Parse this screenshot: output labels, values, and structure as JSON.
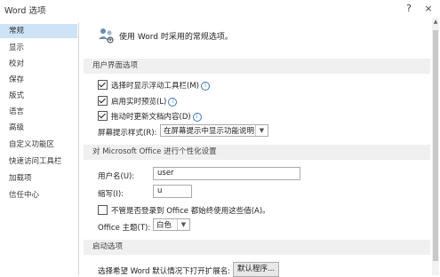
{
  "window": {
    "title": "Word 选项",
    "help": "?",
    "close": "×"
  },
  "sidebar": {
    "items": [
      {
        "label": "常规"
      },
      {
        "label": "显示"
      },
      {
        "label": "校对"
      },
      {
        "label": "保存"
      },
      {
        "label": "版式"
      },
      {
        "label": "语言"
      },
      {
        "label": "高级"
      },
      {
        "label": "自定义功能区"
      },
      {
        "label": "快速访问工具栏"
      },
      {
        "label": "加载项"
      },
      {
        "label": "信任中心"
      }
    ],
    "selected": "常规"
  },
  "main": {
    "intro": "使用 Word 时采用的常规选项。",
    "ui_section": {
      "header": "用户界面选项",
      "options": [
        {
          "label": "选择时显示浮动工具栏(M)",
          "checked": true
        },
        {
          "label": "启用实时预览(L)",
          "checked": true
        },
        {
          "label": "拖动时更新文档内容(D)",
          "checked": true
        }
      ],
      "tooltip_label": "屏幕提示样式(R):",
      "tooltip_value": "在屏幕提示中显示功能说明"
    },
    "personalize_section": {
      "header": "对 Microsoft Office 进行个性化设置",
      "username_label": "用户名(U):",
      "username_value": "user",
      "initials_label": "缩写(I):",
      "initials_value": "u",
      "always_use_label": "不管是否登录到 Office 都始终使用这些值(A)。",
      "always_use_checked": false,
      "theme_label": "Office 主题(T):",
      "theme_value": "白色"
    },
    "startup_section": {
      "header": "启动选项",
      "extensions_label": "选择希望 Word 默认情况下打开扩展名:",
      "default_programs_button": "默认程序..."
    }
  }
}
